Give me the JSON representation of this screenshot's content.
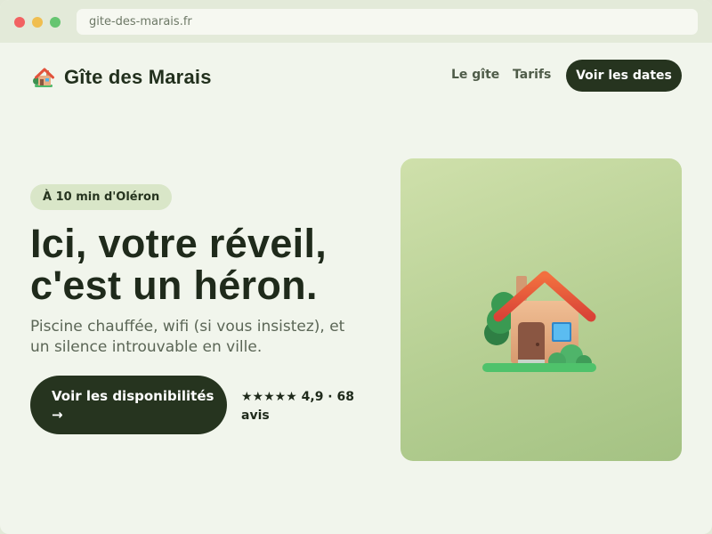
{
  "browser": {
    "url": "gite-des-marais.fr"
  },
  "header": {
    "brand_icon": "house-icon",
    "brand_name": "Gîte des Marais",
    "nav": [
      {
        "label": "Le gîte"
      },
      {
        "label": "Tarifs"
      }
    ],
    "cta_label": "Voir les dates"
  },
  "hero": {
    "tag": "À 10 min d'Oléron",
    "headline_line1": "Ici, votre réveil,",
    "headline_line2": "c'est un héron.",
    "subtitle": "Piscine chauffée, wifi (si vous insistez), et un silence introuvable en ville.",
    "cta_label": "Voir les disponibilités →",
    "rating_text": "★★★★★ 4,9 · 68 avis",
    "illustration_icon": "house-icon"
  },
  "colors": {
    "primary_dark": "#26341f",
    "page_background": "#f1f5ec",
    "tag_background": "#d9e6c8",
    "card_gradient_start": "#cfe0ab",
    "card_gradient_end": "#a4c283"
  }
}
